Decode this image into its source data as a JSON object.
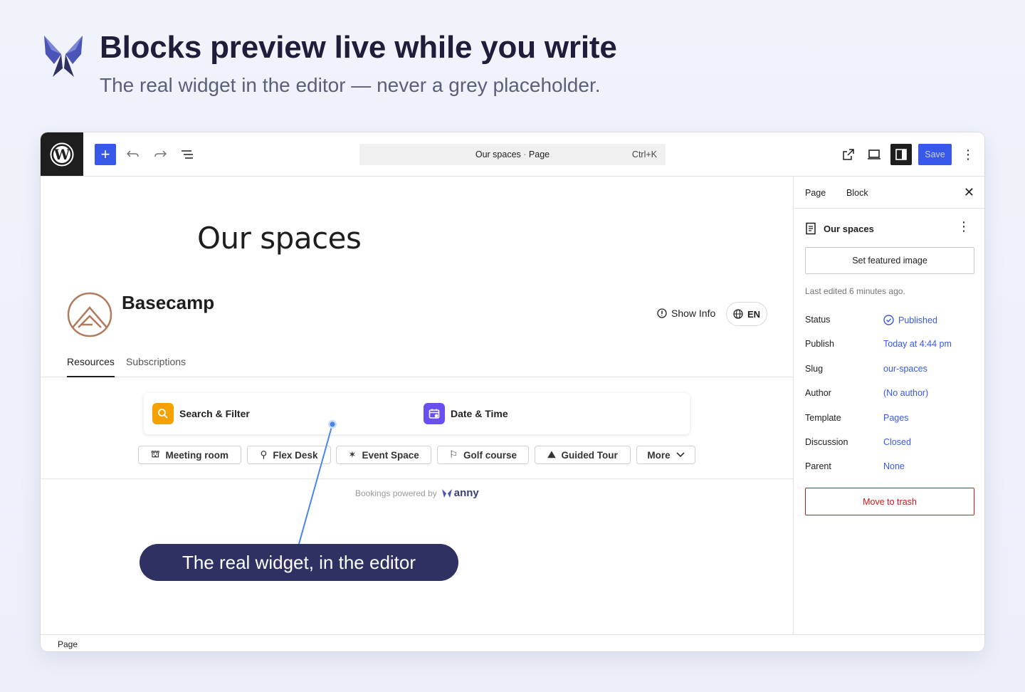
{
  "hero": {
    "title": "Blocks preview live while you write",
    "subtitle": "The real widget in the editor — never a grey placeholder."
  },
  "toolbar": {
    "add_icon": "plus-icon",
    "undo_icon": "undo-icon",
    "redo_icon": "redo-icon",
    "outline_icon": "list-view-icon",
    "command_title": "Our spaces",
    "command_sep": "·",
    "command_type": "Page",
    "command_shortcut": "Ctrl+K",
    "save_label": "Save",
    "accent": "#3858e9"
  },
  "canvas": {
    "page_title": "Our spaces",
    "brand_name": "Basecamp",
    "show_info": "Show Info",
    "language": "EN",
    "tabs": [
      "Resources",
      "Subscriptions"
    ],
    "search_label": "Search & Filter",
    "date_label": "Date & Time",
    "chips": [
      "Meeting room",
      "Flex Desk",
      "Event Space",
      "Golf course",
      "Guided Tour",
      "More"
    ],
    "powered_by": "Bookings powered by",
    "powered_brand": "anny",
    "callout": "The real widget, in the editor"
  },
  "sidebar": {
    "tabs": [
      "Page",
      "Block"
    ],
    "doc_title": "Our spaces",
    "featured_button": "Set featured image",
    "last_edited": "Last edited 6 minutes ago.",
    "meta": [
      {
        "key": "Status",
        "value": "Published"
      },
      {
        "key": "Publish",
        "value": "Today at 4:44 pm"
      },
      {
        "key": "Slug",
        "value": "our-spaces"
      },
      {
        "key": "Author",
        "value": "(No author)"
      },
      {
        "key": "Template",
        "value": "Pages"
      },
      {
        "key": "Discussion",
        "value": "Closed"
      },
      {
        "key": "Parent",
        "value": "None"
      }
    ],
    "trash_button": "Move to trash"
  },
  "statusbar": {
    "breadcrumb": "Page"
  }
}
